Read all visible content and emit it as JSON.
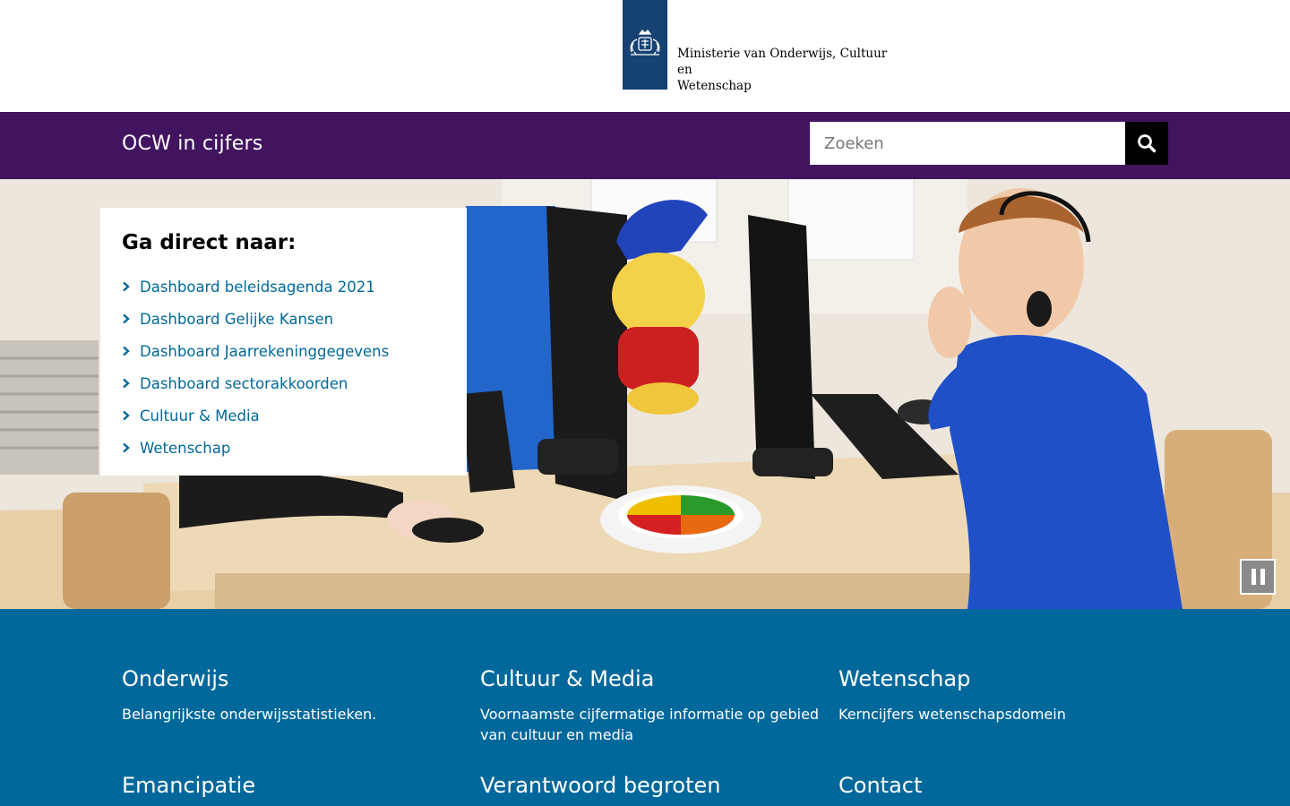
{
  "header": {
    "ministry_line1": "Ministerie van Onderwijs, Cultuur en",
    "ministry_line2": "Wetenschap",
    "logo_icon": "coat-of-arms-icon",
    "brand_color": "#154273"
  },
  "nav": {
    "site_title": "OCW in cijfers",
    "bar_color": "#42145f",
    "search_placeholder": "Zoeken",
    "search_icon": "search-icon"
  },
  "direct": {
    "title": "Ga direct naar:",
    "items": [
      {
        "label": "Dashboard beleidsagenda 2021"
      },
      {
        "label": "Dashboard Gelijke Kansen"
      },
      {
        "label": "Dashboard Jaarrekeninggegevens"
      },
      {
        "label": "Dashboard sectorakkoorden"
      },
      {
        "label": "Cultuur & Media"
      },
      {
        "label": "Wetenschap"
      }
    ],
    "link_color": "#01689b"
  },
  "carousel": {
    "pause_icon": "pause-icon"
  },
  "tiles": {
    "color": "#01689b",
    "items": [
      {
        "title": "Onderwijs",
        "text": "Belangrijkste onderwijsstatistieken."
      },
      {
        "title": "Cultuur & Media",
        "text": "Voornaamste cijfermatige informatie op gebied van cultuur en media"
      },
      {
        "title": "Wetenschap",
        "text": "Kerncijfers wetenschapsdomein"
      },
      {
        "title": "Emancipatie",
        "text": ""
      },
      {
        "title": "Verantwoord begroten",
        "text": ""
      },
      {
        "title": "Contact",
        "text": ""
      }
    ]
  }
}
